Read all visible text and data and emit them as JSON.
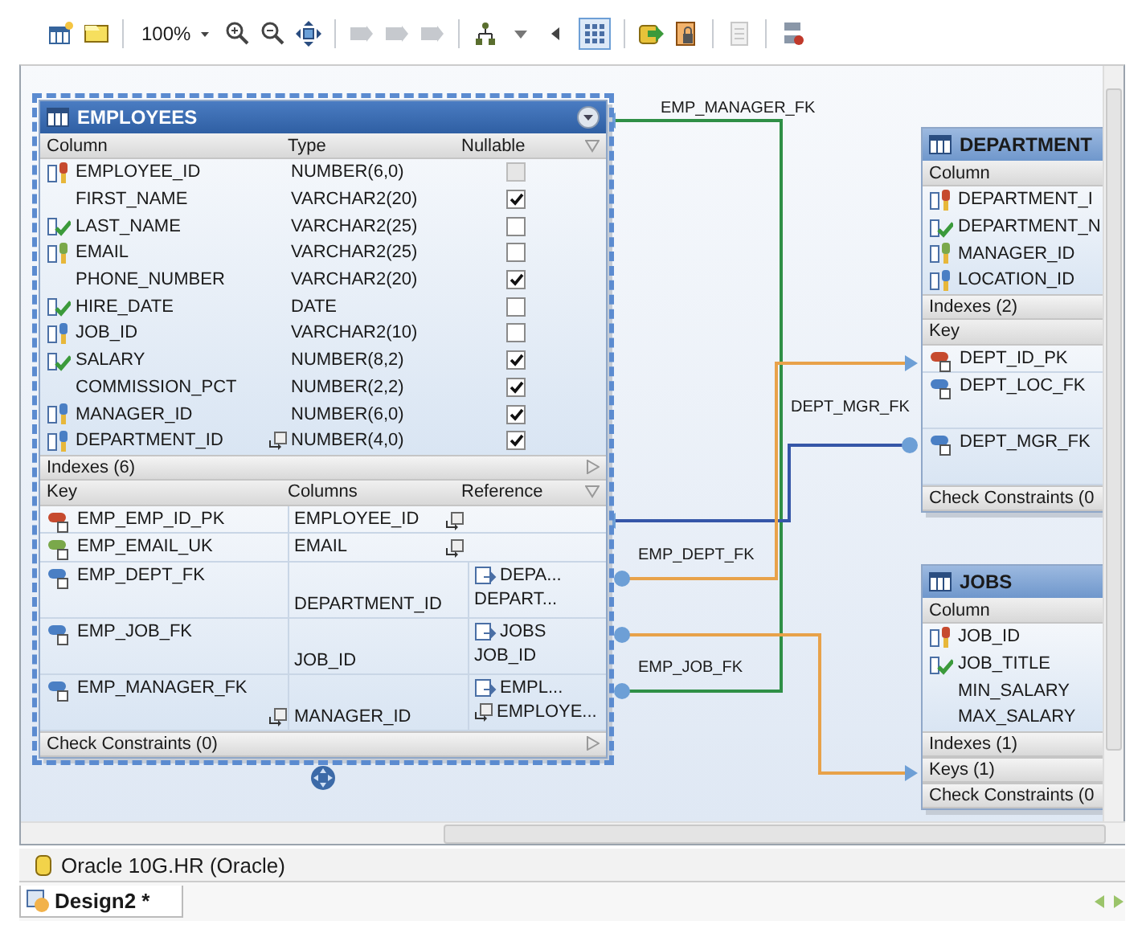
{
  "toolbar": {
    "zoom": "100%",
    "grid_toggle": {
      "selected": true
    }
  },
  "tables": [
    {
      "name": "EMPLOYEES",
      "selected": true,
      "column_headers": [
        "Column",
        "Type",
        "Nullable"
      ],
      "columns": [
        {
          "name": "EMPLOYEE_ID",
          "type": "NUMBER(6,0)",
          "kind": "pk",
          "nullable": false,
          "disabled": true,
          "linked": false
        },
        {
          "name": "FIRST_NAME",
          "type": "VARCHAR2(20)",
          "kind": "plain",
          "nullable": true,
          "disabled": false,
          "linked": false
        },
        {
          "name": "LAST_NAME",
          "type": "VARCHAR2(25)",
          "kind": "nn",
          "nullable": false,
          "disabled": false,
          "linked": false
        },
        {
          "name": "EMAIL",
          "type": "VARCHAR2(25)",
          "kind": "uk",
          "nullable": false,
          "disabled": false,
          "linked": false
        },
        {
          "name": "PHONE_NUMBER",
          "type": "VARCHAR2(20)",
          "kind": "plain",
          "nullable": true,
          "disabled": false,
          "linked": false
        },
        {
          "name": "HIRE_DATE",
          "type": "DATE",
          "kind": "nn",
          "nullable": false,
          "disabled": false,
          "linked": false
        },
        {
          "name": "JOB_ID",
          "type": "VARCHAR2(10)",
          "kind": "fk",
          "nullable": false,
          "disabled": false,
          "linked": false
        },
        {
          "name": "SALARY",
          "type": "NUMBER(8,2)",
          "kind": "nn",
          "nullable": true,
          "disabled": false,
          "linked": false
        },
        {
          "name": "COMMISSION_PCT",
          "type": "NUMBER(2,2)",
          "kind": "plain",
          "nullable": true,
          "disabled": false,
          "linked": false
        },
        {
          "name": "MANAGER_ID",
          "type": "NUMBER(6,0)",
          "kind": "fk",
          "nullable": true,
          "disabled": false,
          "linked": false
        },
        {
          "name": "DEPARTMENT_ID",
          "type": "NUMBER(4,0)",
          "kind": "fk",
          "nullable": true,
          "disabled": false,
          "linked": true
        }
      ],
      "sections": [
        {
          "kind": "bar",
          "label": "Indexes (6)"
        },
        {
          "kind": "grid",
          "headers": [
            "Key",
            "Columns",
            "Reference"
          ],
          "rows": [
            {
              "kind": "pk",
              "key": "EMP_EMP_ID_PK",
              "column": "EMPLOYEE_ID",
              "column_linked": true
            },
            {
              "kind": "uk",
              "key": "EMP_EMAIL_UK",
              "column": "EMAIL",
              "column_linked": true
            },
            {
              "kind": "fk",
              "key": "EMP_DEPT_FK",
              "column": "DEPARTMENT_ID",
              "column_linked": false,
              "ref_table": "DEPA...",
              "ref_column": "DEPART...",
              "ref_linked": false
            },
            {
              "kind": "fk",
              "key": "EMP_JOB_FK",
              "column": "JOB_ID",
              "column_linked": false,
              "ref_table": "JOBS",
              "ref_column": "JOB_ID",
              "ref_linked": false
            },
            {
              "kind": "fk",
              "key": "EMP_MANAGER_FK",
              "column": "MANAGER_ID",
              "column_linked": true,
              "ref_table": "EMPL...",
              "ref_column": "EMPLOYE...",
              "ref_linked": true
            }
          ]
        },
        {
          "kind": "bar",
          "label": "Check Constraints (0)"
        }
      ]
    },
    {
      "name": "DEPARTMENT",
      "selected": false,
      "column_headers": [
        "Column"
      ],
      "columns": [
        {
          "name": "DEPARTMENT_I",
          "kind": "pk"
        },
        {
          "name": "DEPARTMENT_N",
          "kind": "nn"
        },
        {
          "name": "MANAGER_ID",
          "kind": "uk"
        },
        {
          "name": "LOCATION_ID",
          "kind": "fk"
        }
      ],
      "sections": [
        {
          "kind": "bar",
          "label": "Indexes (2)"
        },
        {
          "kind": "grid",
          "headers": [
            "Key"
          ],
          "rows": [
            {
              "kind": "pk",
              "key": "DEPT_ID_PK"
            },
            {
              "kind": "fk",
              "key": "DEPT_LOC_FK"
            },
            {
              "kind": "fk",
              "key": "DEPT_MGR_FK"
            }
          ]
        },
        {
          "kind": "bar",
          "label": "Check Constraints (0"
        }
      ]
    },
    {
      "name": "JOBS",
      "selected": false,
      "column_headers": [
        "Column"
      ],
      "columns": [
        {
          "name": "JOB_ID",
          "kind": "pk"
        },
        {
          "name": "JOB_TITLE",
          "kind": "nn"
        },
        {
          "name": "MIN_SALARY",
          "kind": "plain"
        },
        {
          "name": "MAX_SALARY",
          "kind": "plain"
        }
      ],
      "sections": [
        {
          "kind": "bar",
          "label": "Indexes (1)"
        },
        {
          "kind": "bar",
          "label": "Keys (1)"
        },
        {
          "kind": "bar",
          "label": "Check Constraints (0"
        }
      ]
    }
  ],
  "relations": [
    {
      "label": "EMP_MANAGER_FK",
      "color": "#2f8f46"
    },
    {
      "label": "DEPT_MGR_FK",
      "color": "#3556a8"
    },
    {
      "label": "EMP_DEPT_FK",
      "color": "#e8a24a"
    },
    {
      "label": "EMP_JOB_FK",
      "color": "#e8a24a"
    }
  ],
  "status_bar": {
    "connection": "Oracle 10G.HR (Oracle)"
  },
  "tabs": [
    {
      "label": "Design2 *",
      "selected": true
    }
  ]
}
